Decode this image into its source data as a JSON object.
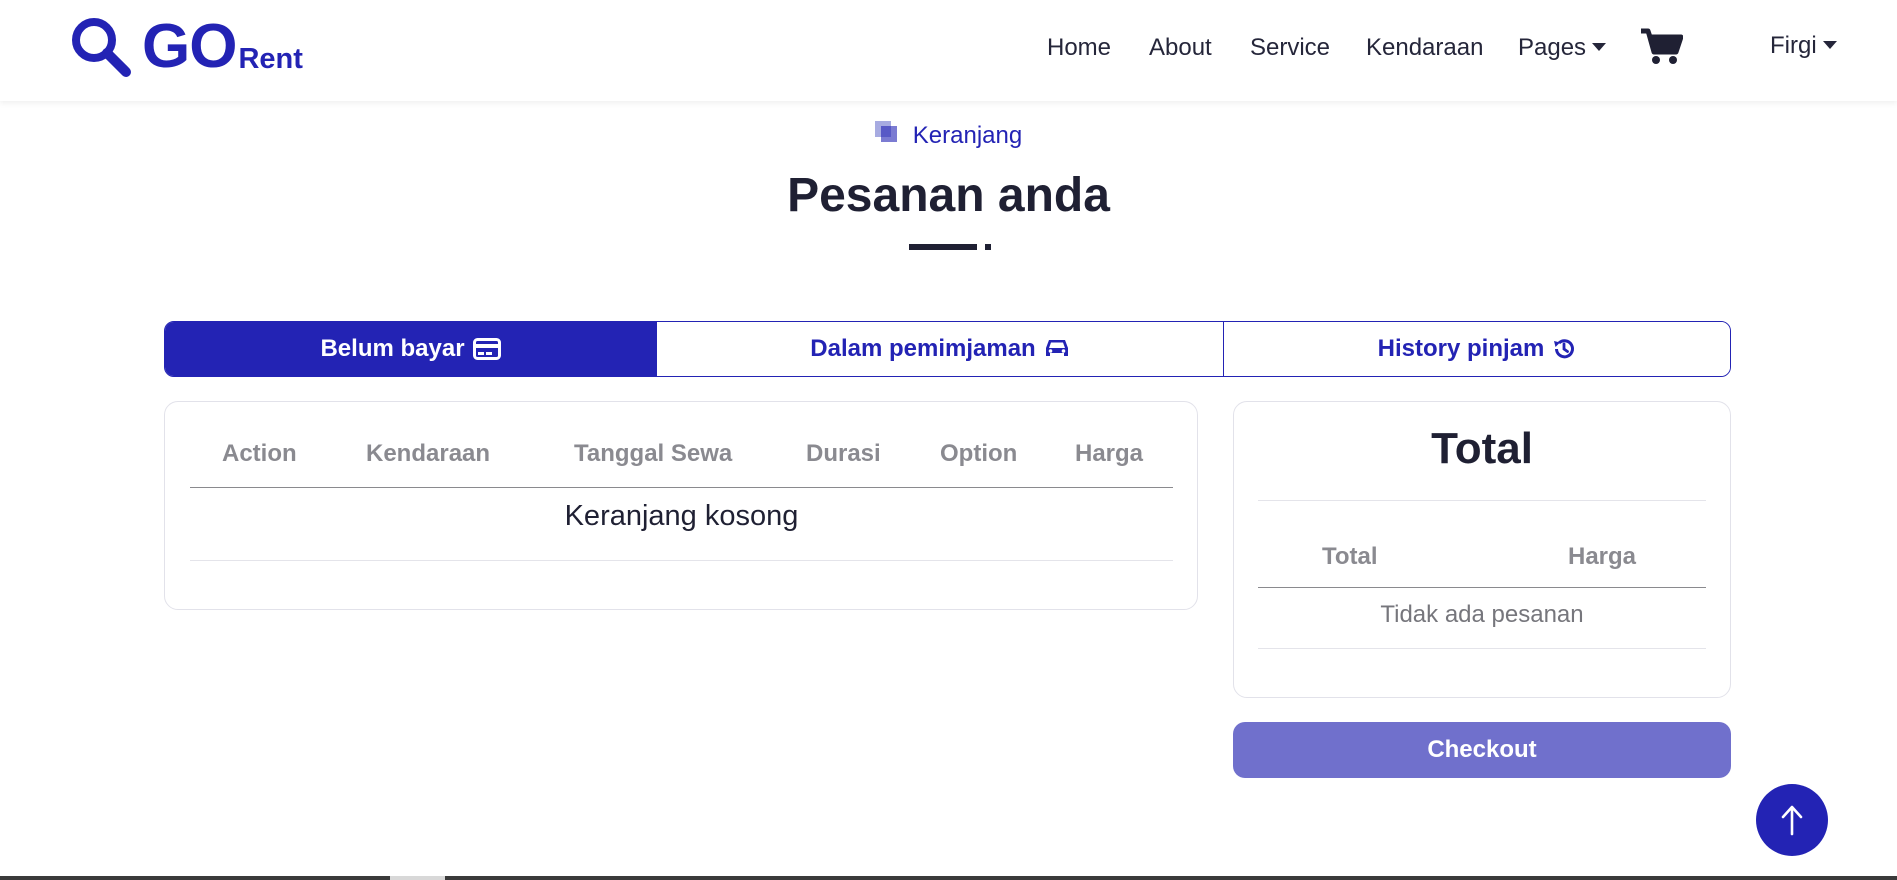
{
  "brand": {
    "main": "GO",
    "sub": "Rent"
  },
  "nav": {
    "home": "Home",
    "about": "About",
    "service": "Service",
    "kendaraan": "Kendaraan",
    "pages": "Pages",
    "user": "Firgi"
  },
  "section": {
    "subtitle": "Keranjang",
    "title": "Pesanan anda"
  },
  "tabs": [
    {
      "label": "Belum bayar",
      "icon": "credit-card-icon",
      "active": true
    },
    {
      "label": "Dalam pemimjaman",
      "icon": "car-icon",
      "active": false
    },
    {
      "label": "History pinjam",
      "icon": "history-icon",
      "active": false
    }
  ],
  "cart_table": {
    "headers": [
      "Action",
      "Kendaraan",
      "Tanggal Sewa",
      "Durasi",
      "Option",
      "Harga"
    ],
    "empty_text": "Keranjang kosong"
  },
  "summary": {
    "title": "Total",
    "headers": [
      "Total",
      "Harga"
    ],
    "empty_text": "Tidak ada pesanan"
  },
  "checkout_label": "Checkout",
  "colors": {
    "primary": "#2323b4",
    "checkout": "#7070cc",
    "muted_header": "#8a8a90"
  }
}
